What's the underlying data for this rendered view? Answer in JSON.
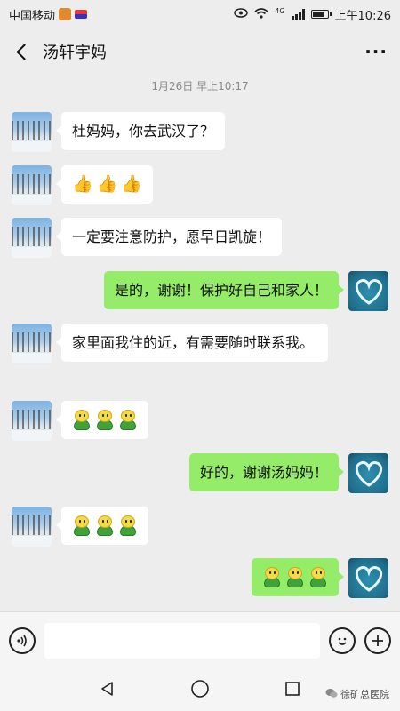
{
  "status_bar": {
    "carrier": "中国移动",
    "network": "4G",
    "time": "上午10:26"
  },
  "header": {
    "title": "汤轩宇妈"
  },
  "chat": {
    "timestamp": "1月26日 早上10:17",
    "messages": [
      {
        "side": "left",
        "text": "杜妈妈，你去武汉了？"
      },
      {
        "side": "left",
        "emoji": "thumbs-up x3"
      },
      {
        "side": "left",
        "text": "一定要注意防护，愿早日凯旋！"
      },
      {
        "side": "right",
        "text": "是的，谢谢！保护好自己和家人！"
      },
      {
        "side": "left",
        "text": "家里面我住的近，有需要随时联系我。"
      },
      {
        "side": "left",
        "emoji": "chick x3"
      },
      {
        "side": "right",
        "text": "好的，谢谢汤妈妈！"
      },
      {
        "side": "left",
        "emoji": "chick x3"
      },
      {
        "side": "right",
        "emoji": "chick x3"
      }
    ]
  },
  "watermark": "徐矿总医院",
  "colors": {
    "background": "#ededed",
    "sent_bubble": "#95ec69",
    "received_bubble": "#ffffff"
  }
}
